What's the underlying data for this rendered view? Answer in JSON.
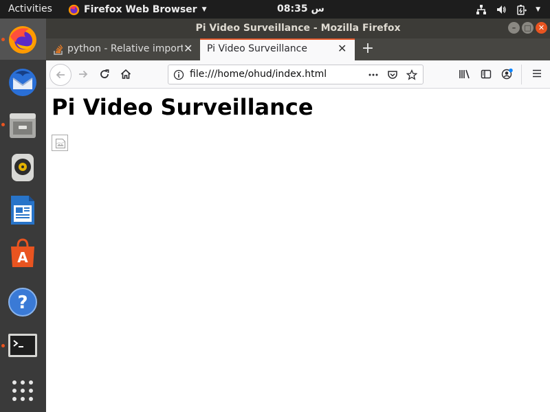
{
  "topbar": {
    "activities": "Activities",
    "app_name": "Firefox Web Browser",
    "clock": "08:35 س"
  },
  "dock": {
    "items": [
      "firefox-icon",
      "thunderbird-icon",
      "files-icon",
      "rhythmbox-icon",
      "writer-icon",
      "software-icon",
      "help-icon",
      "terminal-icon",
      "show-apps-icon"
    ]
  },
  "window": {
    "title": "Pi Video Surveillance - Mozilla Firefox"
  },
  "tabs": [
    {
      "label": "python - Relative imports",
      "active": false
    },
    {
      "label": "Pi Video Surveillance",
      "active": true
    }
  ],
  "urlbar": {
    "url": "file:///home/ohud/index.html"
  },
  "page": {
    "heading": "Pi Video Surveillance"
  },
  "colors": {
    "accent": "#e95420",
    "tab_accent": "#e2592b"
  }
}
